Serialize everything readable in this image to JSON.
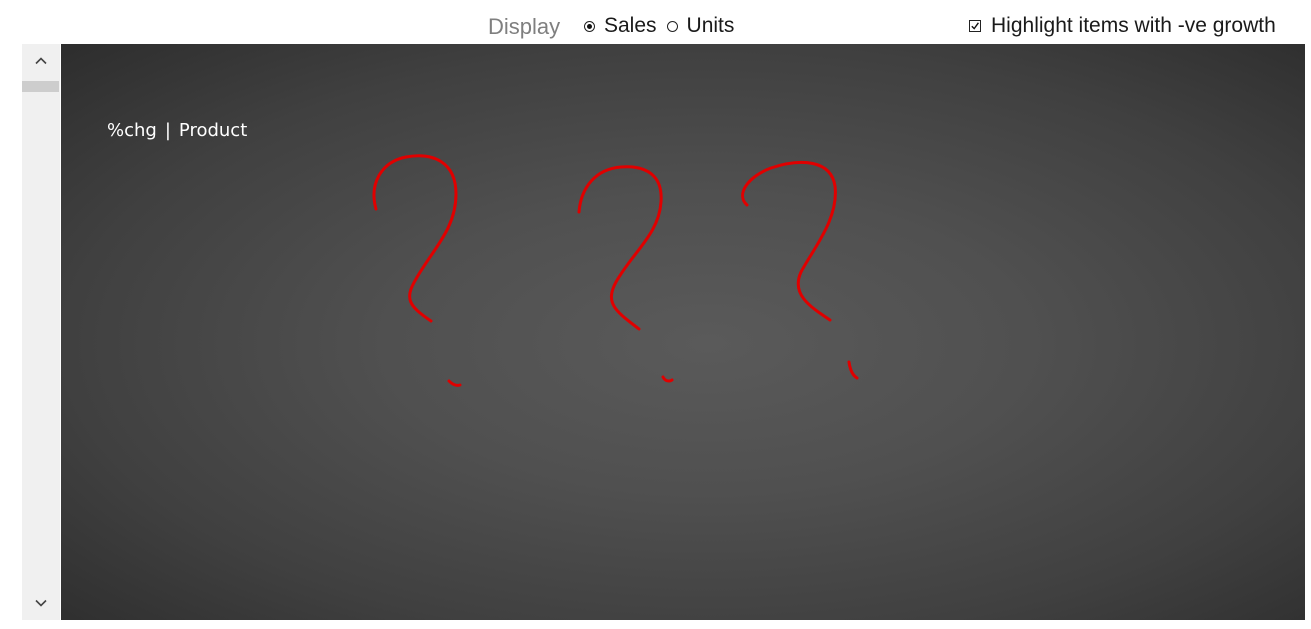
{
  "controls": {
    "display_label": "Display",
    "radio_options": [
      {
        "label": "Sales",
        "checked": true
      },
      {
        "label": "Units",
        "checked": false
      }
    ],
    "highlight_label": "Highlight items with -ve growth",
    "highlight_checked": true
  },
  "scrollbar": {
    "up_icon": "chevron-up-icon",
    "down_icon": "chevron-down-icon"
  },
  "panel": {
    "header_left": "%chg",
    "header_separator": "|",
    "header_right": "Product",
    "drawing_color": "#e00000",
    "drawing": "question-marks-scribble"
  }
}
